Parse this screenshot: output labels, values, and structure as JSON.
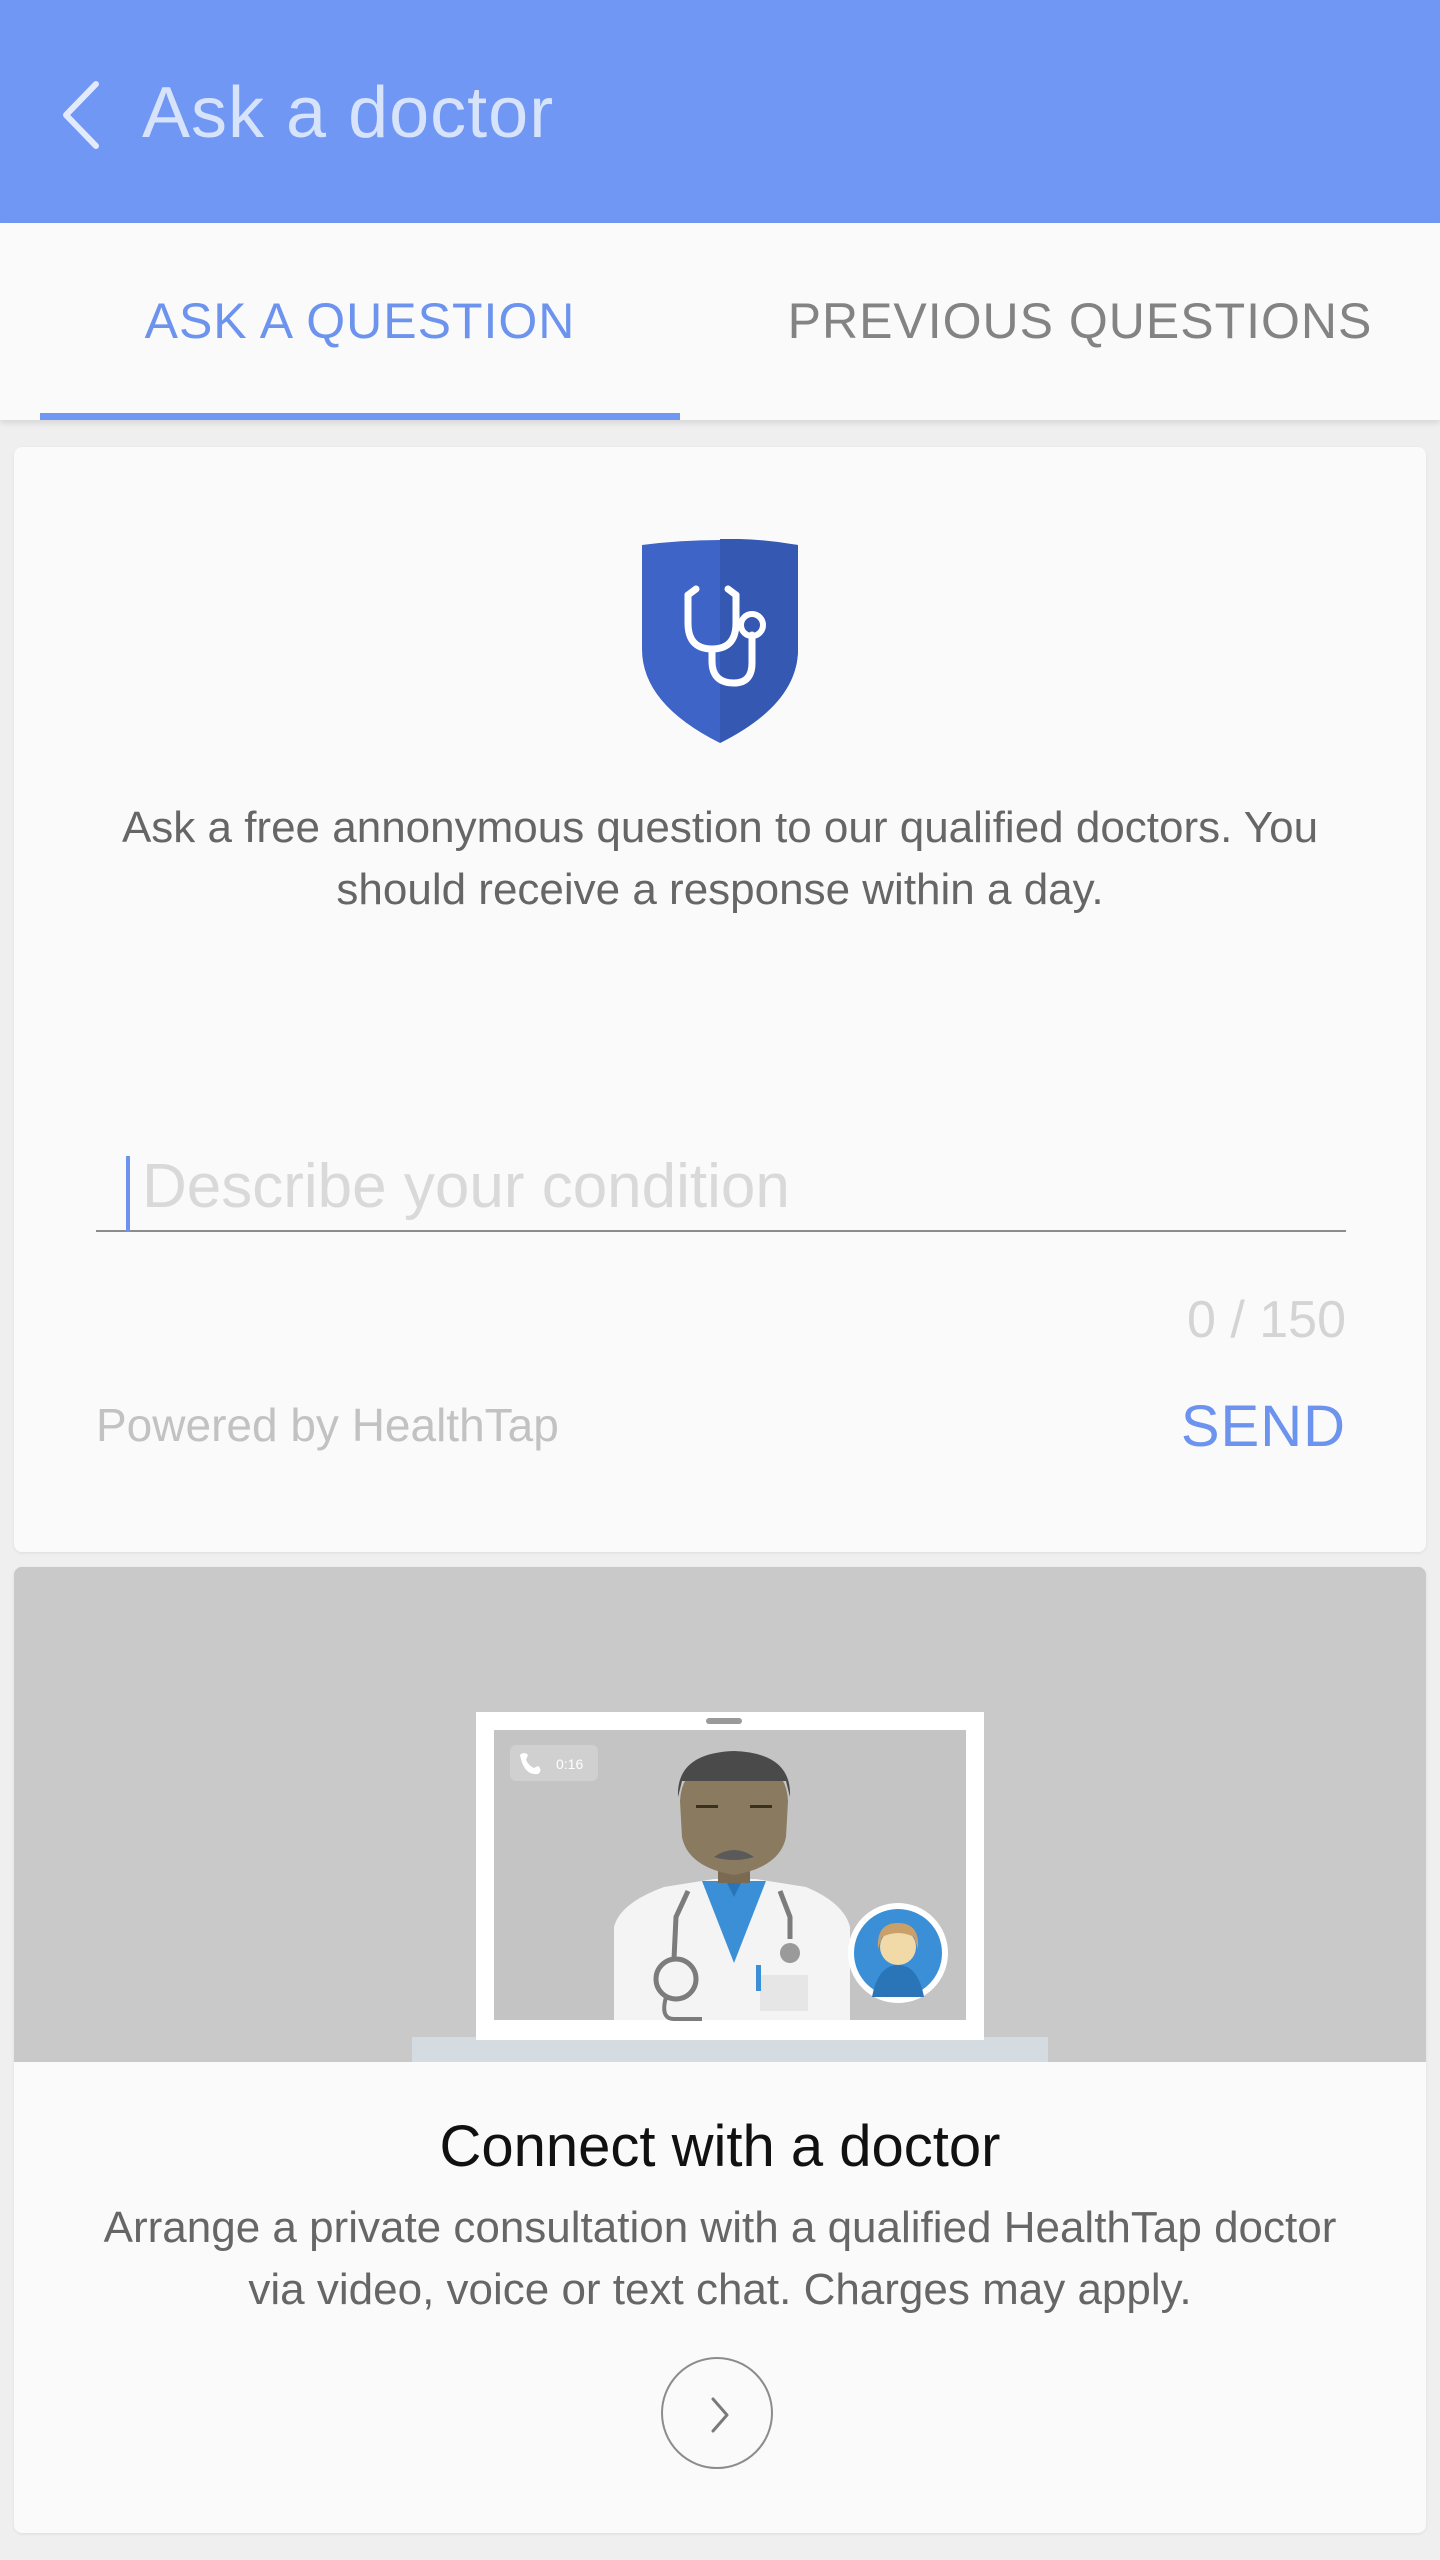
{
  "app_bar": {
    "title": "Ask a doctor",
    "back_icon": "chevron-left-icon",
    "color": "#6f97f3"
  },
  "tabs": [
    {
      "label": "ASK A QUESTION",
      "active": true
    },
    {
      "label": "PREVIOUS QUESTIONS",
      "active": false
    }
  ],
  "ask_card": {
    "icon": "shield-stethoscope-icon",
    "description": "Ask a free annonymous question to our qualified doctors. You should receive a response within a day.",
    "input": {
      "placeholder": "Describe your condition",
      "value": ""
    },
    "counter": "0 / 150",
    "powered_by": "Powered by HealthTap",
    "send_label": "SEND"
  },
  "connect_card": {
    "call_timer": "0:16",
    "title": "Connect with a doctor",
    "description": "Arrange a private consultation with a qualified HealthTap doctor via video, voice or text chat. Charges may apply.",
    "next_icon": "chevron-right-icon"
  },
  "colors": {
    "accent": "#6c93ee",
    "shield": "#3e64c8"
  }
}
